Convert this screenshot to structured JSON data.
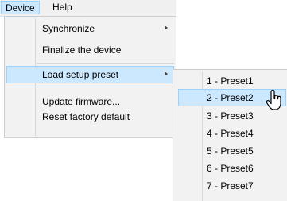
{
  "menubar": {
    "items": [
      {
        "label": "Device",
        "active": true
      },
      {
        "label": "Help",
        "active": false
      }
    ]
  },
  "device_menu": {
    "items": [
      {
        "label": "Synchronize",
        "has_submenu": true
      },
      {
        "label": "Finalize the device",
        "has_submenu": false
      },
      {
        "label": "Load setup preset",
        "has_submenu": true,
        "highlighted": true
      },
      {
        "label": "Update firmware...",
        "has_submenu": false
      },
      {
        "label": "Reset factory default",
        "has_submenu": false
      }
    ]
  },
  "preset_submenu": {
    "items": [
      {
        "label": "1 - Preset1"
      },
      {
        "label": "2 - Preset2",
        "highlighted": true
      },
      {
        "label": "3 - Preset3"
      },
      {
        "label": "4 - Preset4"
      },
      {
        "label": "5 - Preset5"
      },
      {
        "label": "6 - Preset6"
      },
      {
        "label": "7 - Preset7"
      }
    ]
  },
  "cursor": {
    "icon": "arrow-pointer-icon"
  },
  "colors": {
    "highlight_fill": "#cce8ff",
    "highlight_border": "#99d1ff",
    "menu_bg": "#f2f2f2"
  }
}
